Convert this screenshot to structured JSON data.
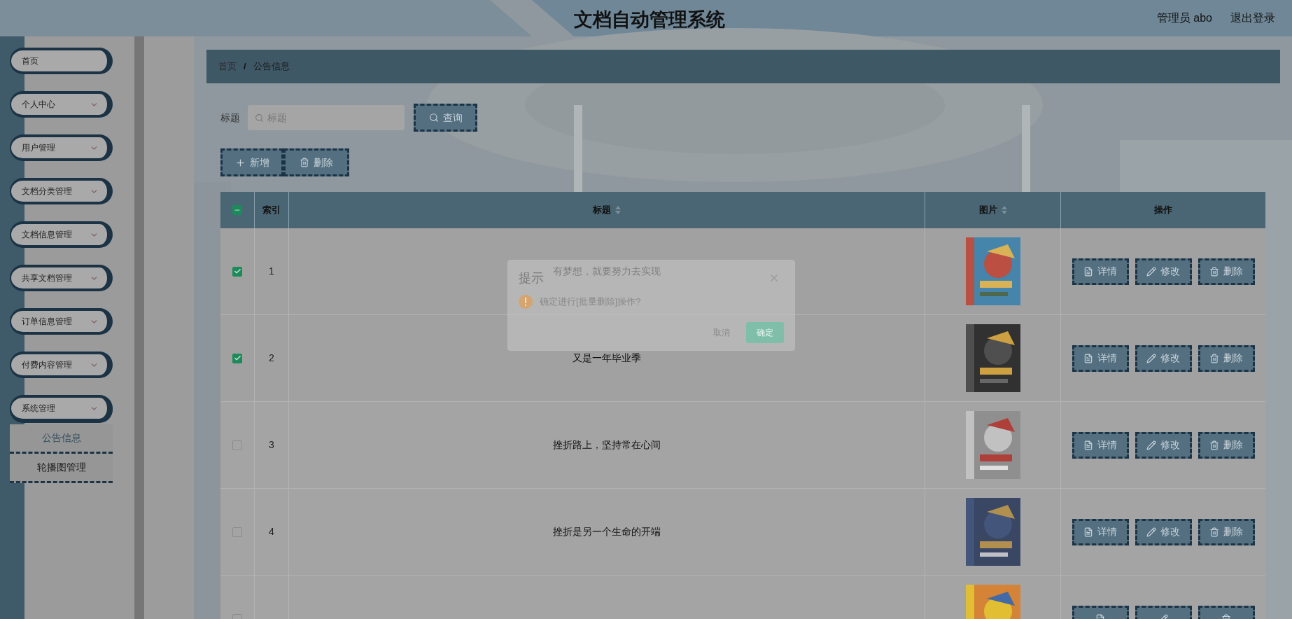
{
  "header": {
    "title": "文档自动管理系统",
    "user": "管理员 abo",
    "logout": "退出登录"
  },
  "sidebar": {
    "items": [
      {
        "label": "首页",
        "kind": "link",
        "expanded": false
      },
      {
        "label": "个人中心",
        "kind": "submenu",
        "expanded": false
      },
      {
        "label": "用户管理",
        "kind": "submenu",
        "expanded": false
      },
      {
        "label": "文档分类管理",
        "kind": "submenu",
        "expanded": false
      },
      {
        "label": "文档信息管理",
        "kind": "submenu",
        "expanded": false
      },
      {
        "label": "共享文档管理",
        "kind": "submenu",
        "expanded": false
      },
      {
        "label": "订单信息管理",
        "kind": "submenu",
        "expanded": false
      },
      {
        "label": "付费内容管理",
        "kind": "submenu",
        "expanded": false
      },
      {
        "label": "系统管理",
        "kind": "submenu",
        "expanded": true,
        "children": [
          {
            "label": "公告信息",
            "selected": true
          },
          {
            "label": "轮播图管理",
            "selected": false
          }
        ]
      }
    ]
  },
  "breadcrumb": {
    "items": [
      "首页",
      "公告信息"
    ],
    "separator": "/"
  },
  "search": {
    "label": "标题",
    "placeholder": "标题",
    "button": "查询"
  },
  "toolbar": [
    {
      "kind": "add",
      "label": "新增"
    },
    {
      "kind": "delete",
      "label": "删除"
    }
  ],
  "table": {
    "select_all": {
      "indeterminate": true
    },
    "columns": [
      {
        "label": "索引",
        "sortable": false
      },
      {
        "label": "标题",
        "sortable": true
      },
      {
        "label": "图片",
        "sortable": true
      },
      {
        "label": "操作",
        "sortable": false
      }
    ],
    "rows": [
      {
        "checked": true,
        "index": "1",
        "title": "有梦想，就要努力去实现",
        "image": {
          "kind": "picture"
        },
        "actions": [
          {
            "kind": "detail",
            "label": "详情"
          },
          {
            "kind": "edit",
            "label": "修改"
          },
          {
            "kind": "delete",
            "label": "删除"
          }
        ]
      },
      {
        "checked": true,
        "index": "2",
        "title": "又是一年毕业季",
        "image": {
          "kind": "picture"
        },
        "actions": [
          {
            "kind": "detail",
            "label": "详情"
          },
          {
            "kind": "edit",
            "label": "修改"
          },
          {
            "kind": "delete",
            "label": "删除"
          }
        ]
      },
      {
        "checked": false,
        "index": "3",
        "title": "挫折路上，坚持常在心间",
        "image": {
          "kind": "picture"
        },
        "actions": [
          {
            "kind": "detail",
            "label": "详情"
          },
          {
            "kind": "edit",
            "label": "修改"
          },
          {
            "kind": "delete",
            "label": "删除"
          }
        ]
      },
      {
        "checked": false,
        "index": "4",
        "title": "挫折是另一个生命的开端",
        "image": {
          "kind": "picture"
        },
        "actions": [
          {
            "kind": "detail",
            "label": "详情"
          },
          {
            "kind": "edit",
            "label": "修改"
          },
          {
            "kind": "delete",
            "label": "删除"
          }
        ]
      },
      {
        "checked": false,
        "image": {
          "kind": "picture"
        },
        "actions": [
          {
            "kind": "detail"
          },
          {
            "kind": "edit"
          },
          {
            "kind": "delete"
          }
        ]
      }
    ]
  },
  "dialog": {
    "title": "提示",
    "message": "确定进行[批量删除]操作?",
    "buttons": [
      {
        "kind": "cancel",
        "label": "取消"
      },
      {
        "kind": "confirm",
        "label": "确定"
      }
    ]
  }
}
